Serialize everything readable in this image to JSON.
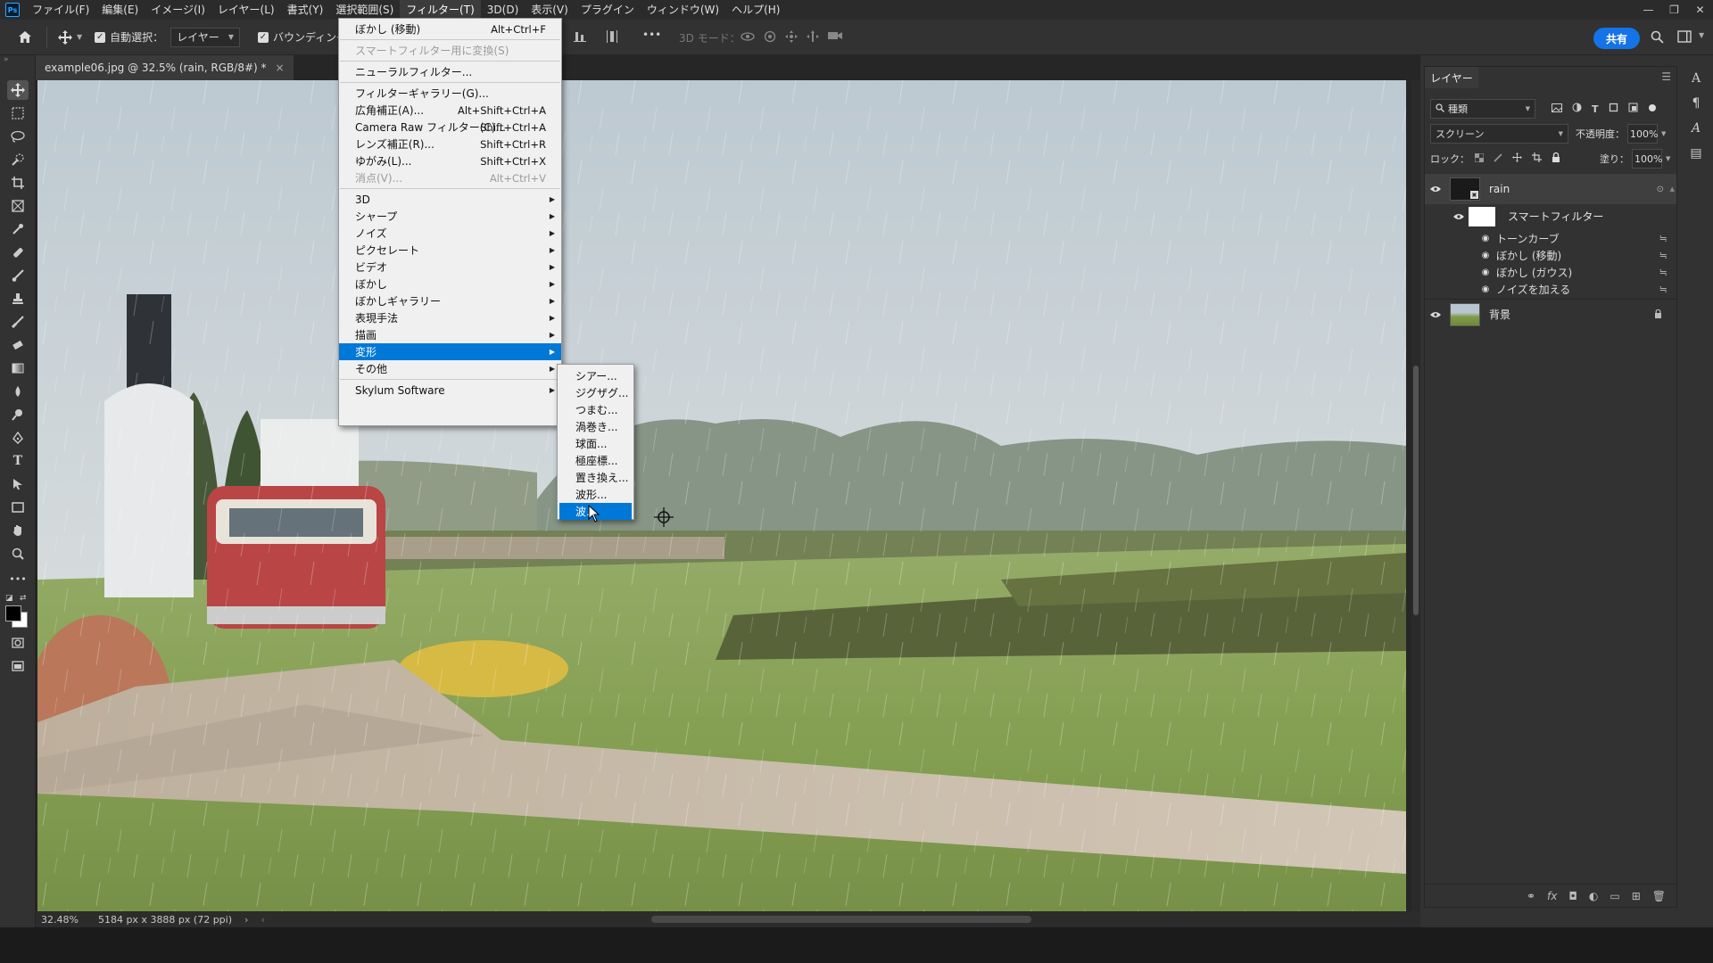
{
  "app": {
    "logo": "Ps"
  },
  "menubar": {
    "items": [
      "ファイル(F)",
      "編集(E)",
      "イメージ(I)",
      "レイヤー(L)",
      "書式(Y)",
      "選択範囲(S)",
      "フィルター(T)",
      "3D(D)",
      "表示(V)",
      "プラグイン",
      "ウィンドウ(W)",
      "ヘルプ(H)"
    ],
    "active_index": 6,
    "window_controls": [
      "—",
      "❐",
      "✕"
    ]
  },
  "options": {
    "auto_select_label": "自動選択：",
    "auto_select_value": "レイヤー",
    "bounding_label": "バウンディングボ",
    "mode_3d_label": "3D モード：",
    "more": "•••",
    "share": "共有"
  },
  "document": {
    "tab_title": "example06.jpg @ 32.5% (rain, RGB/8#) *",
    "tab_close": "×",
    "zoom": "32.48%",
    "doc_size": "5184 px x 3888 px (72 ppi)"
  },
  "filter_menu": {
    "items": [
      {
        "label": "ぼかし (移動)",
        "shortcut": "Alt+Ctrl+F",
        "disabled": false,
        "submenu": false
      },
      {
        "sep": true
      },
      {
        "label": "スマートフィルター用に変換(S)",
        "shortcut": "",
        "disabled": true,
        "submenu": false
      },
      {
        "sep": true
      },
      {
        "label": "ニューラルフィルター...",
        "shortcut": "",
        "disabled": false,
        "submenu": false
      },
      {
        "sep": true
      },
      {
        "label": "フィルターギャラリー(G)...",
        "shortcut": "",
        "disabled": false,
        "submenu": false
      },
      {
        "label": "広角補正(A)...",
        "shortcut": "Alt+Shift+Ctrl+A",
        "disabled": false,
        "submenu": false
      },
      {
        "label": "Camera Raw フィルター(C)...",
        "shortcut": "Shift+Ctrl+A",
        "disabled": false,
        "submenu": false
      },
      {
        "label": "レンズ補正(R)...",
        "shortcut": "Shift+Ctrl+R",
        "disabled": false,
        "submenu": false
      },
      {
        "label": "ゆがみ(L)...",
        "shortcut": "Shift+Ctrl+X",
        "disabled": false,
        "submenu": false
      },
      {
        "label": "消点(V)...",
        "shortcut": "Alt+Ctrl+V",
        "disabled": true,
        "submenu": false
      },
      {
        "sep": true
      },
      {
        "label": "3D",
        "shortcut": "",
        "disabled": false,
        "submenu": true
      },
      {
        "label": "シャープ",
        "shortcut": "",
        "disabled": false,
        "submenu": true
      },
      {
        "label": "ノイズ",
        "shortcut": "",
        "disabled": false,
        "submenu": true
      },
      {
        "label": "ピクセレート",
        "shortcut": "",
        "disabled": false,
        "submenu": true
      },
      {
        "label": "ビデオ",
        "shortcut": "",
        "disabled": false,
        "submenu": true
      },
      {
        "label": "ぼかし",
        "shortcut": "",
        "disabled": false,
        "submenu": true
      },
      {
        "label": "ぼかしギャラリー",
        "shortcut": "",
        "disabled": false,
        "submenu": true
      },
      {
        "label": "表現手法",
        "shortcut": "",
        "disabled": false,
        "submenu": true
      },
      {
        "label": "描画",
        "shortcut": "",
        "disabled": false,
        "submenu": true
      },
      {
        "label": "変形",
        "shortcut": "",
        "disabled": false,
        "submenu": true,
        "highlighted": true
      },
      {
        "label": "その他",
        "shortcut": "",
        "disabled": false,
        "submenu": true
      },
      {
        "sep": true
      },
      {
        "label": "Skylum Software",
        "shortcut": "",
        "disabled": false,
        "submenu": true
      }
    ]
  },
  "distort_menu": {
    "items": [
      "シアー...",
      "ジグザグ...",
      "つまむ...",
      "渦巻き...",
      "球面...",
      "極座標...",
      "置き換え...",
      "波形...",
      "波..."
    ],
    "highlighted_index": 8
  },
  "layers_panel": {
    "tab": "レイヤー",
    "filter_kind": "種類",
    "blend_mode": "スクリーン",
    "opacity_label": "不透明度：",
    "opacity_value": "100%",
    "lock_label": "ロック：",
    "fill_label": "塗り：",
    "fill_value": "100%",
    "layers": [
      {
        "name": "rain",
        "smart": true
      },
      {
        "name": "背景",
        "locked": true
      }
    ],
    "smart_filter_label": "スマートフィルター",
    "smart_filters": [
      "トーンカーブ",
      "ぼかし (移動)",
      "ぼかし (ガウス)",
      "ノイズを加える"
    ]
  },
  "colors": {
    "accent": "#0078d7",
    "share": "#1473e6",
    "menu_bg": "#f0f0f0",
    "ui_bg": "#323232"
  }
}
